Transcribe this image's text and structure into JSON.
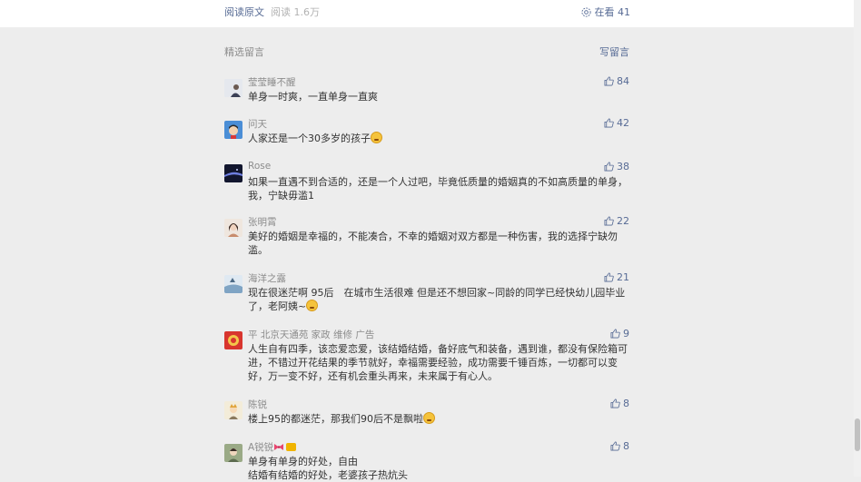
{
  "top_bar": {
    "read_original": "阅读原文",
    "read_count": "阅读 1.6万",
    "watching": "在看 41"
  },
  "section": {
    "title": "精选留言",
    "write_comment": "写留言"
  },
  "comments": [
    {
      "nickname": "莹莹睡不醒",
      "content": "单身一时爽，一直单身一直爽",
      "likes": "84",
      "avatar_color": "#c9cfd9"
    },
    {
      "nickname": "问天",
      "content": "人家还是一个30多岁的孩子",
      "likes": "42",
      "avatar_color": "#4b8ed6"
    },
    {
      "nickname": "Rose",
      "content": "如果一直遇不到合适的，还是一个人过吧，毕竟低质量的婚姻真的不如高质量的单身，我，宁缺毋滥1",
      "likes": "38",
      "avatar_color": "#1a1f3a"
    },
    {
      "nickname": "张明霄",
      "content": "美好的婚姻是幸福的，不能凑合，不幸的婚姻对双方都是一种伤害，我的选择宁缺勿滥。",
      "likes": "22",
      "avatar_color": "#d6b8a3"
    },
    {
      "nickname": "海洋之露",
      "content": "现在很迷茫啊 95后　在城市生活很难 但是还不想回家~同龄的同学已经快幼儿园毕业了，老阿姨~",
      "likes": "21",
      "avatar_color": "#a8c2d8"
    },
    {
      "nickname": "平 北京天通苑 家政 维修 广告",
      "content": "人生自有四季，该恋爱恋爱，该结婚结婚，备好底气和装备，遇到谁，都没有保险箱可进，不错过开花结果的季节就好，幸福需要经验，成功需要千锤百炼，一切都可以变好，万一变不好，还有机会重头再来，未来属于有心人。",
      "likes": "9",
      "avatar_color": "#e0433a"
    },
    {
      "nickname": "陈锐",
      "content": "楼上95的都迷茫，那我们90后不是飘啦",
      "likes": "8",
      "avatar_color": "#efe4c8"
    },
    {
      "nickname": "A锐锐",
      "content_line1": "单身有单身的好处，自由",
      "content_line2": "结婚有结婚的好处，老婆孩子热炕头",
      "likes": "8",
      "avatar_color": "#8a9c7a"
    }
  ],
  "colors": {
    "link": "#576b95",
    "muted": "#8c8c8c",
    "background": "#ededed"
  }
}
